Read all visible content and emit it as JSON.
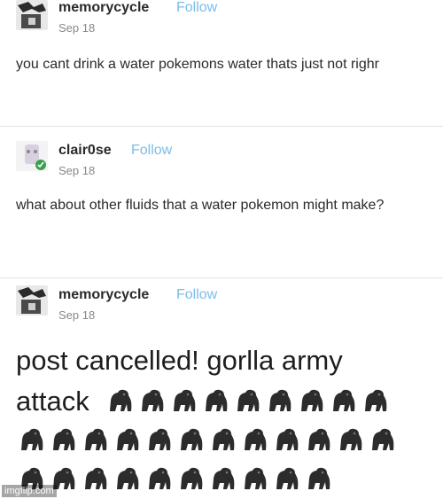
{
  "posts": [
    {
      "username": "memorycycle",
      "follow_label": "Follow",
      "date": "Sep 18",
      "body": "you cant drink a water pokemons water thats just not righr"
    },
    {
      "username": "clair0se",
      "follow_label": "Follow",
      "date": "Sep 18",
      "body": "what about other fluids that a water pokemon might make?"
    },
    {
      "username": "memorycycle",
      "follow_label": "Follow",
      "date": "Sep 18",
      "body_line1": "post cancelled! gorlla army",
      "body_line2": "attack"
    }
  ],
  "gorilla_icon": "gorilla-icon",
  "watermark": "imgflip.com",
  "colors": {
    "follow": "#7bbde8",
    "text": "#2a2a2a",
    "date": "#888888"
  }
}
